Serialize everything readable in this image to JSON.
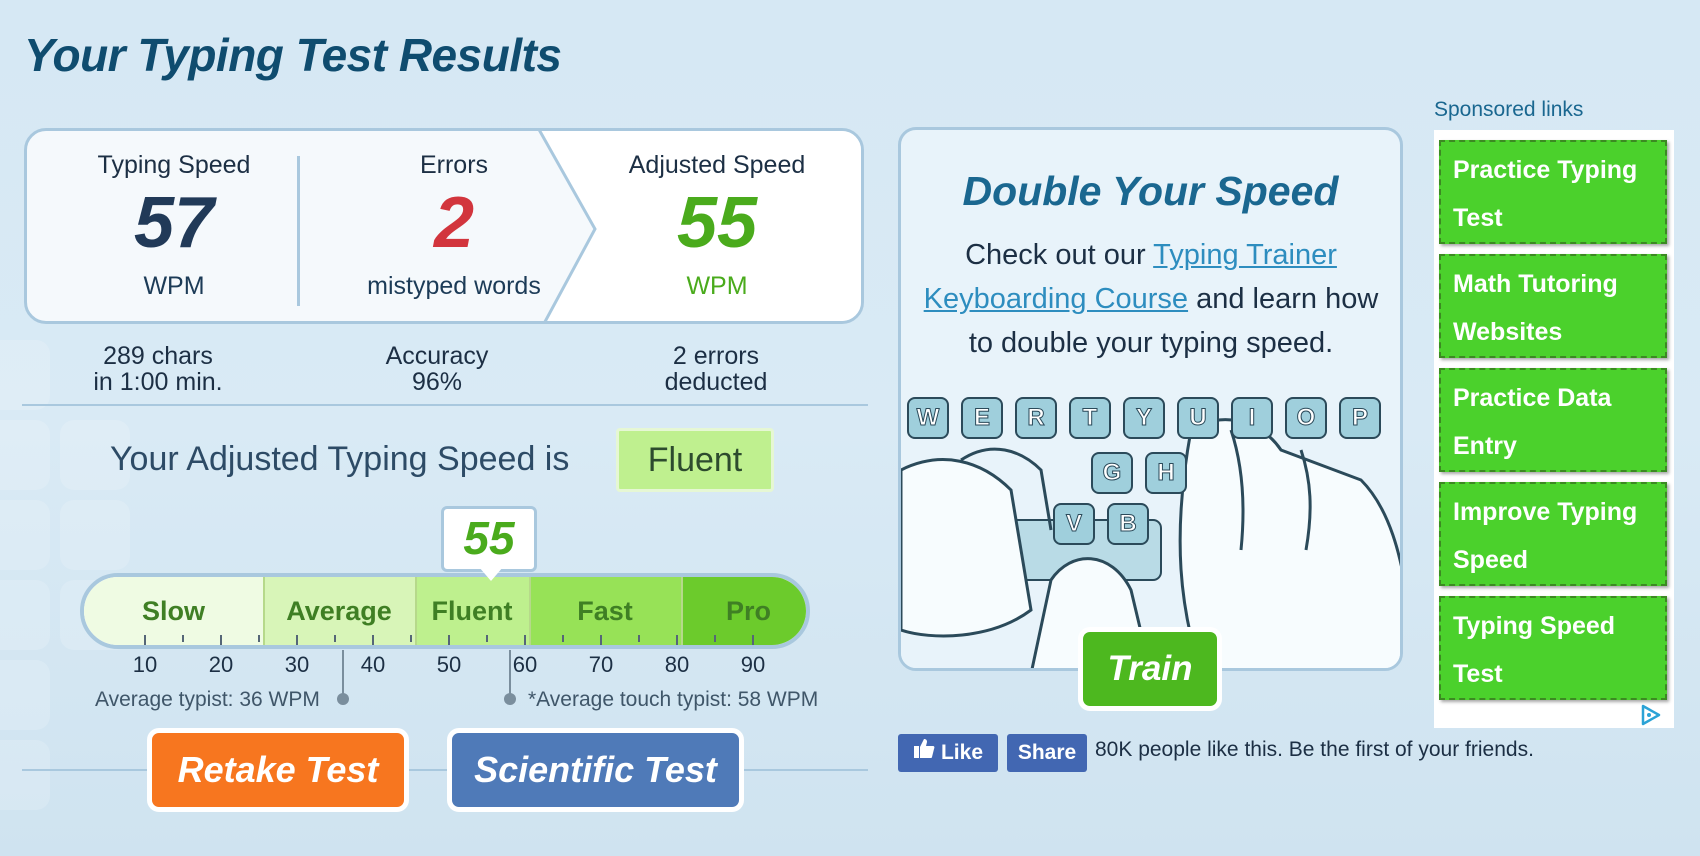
{
  "page": {
    "title": "Your Typing Test Results"
  },
  "results": {
    "typing_speed": {
      "label": "Typing Speed",
      "value": "57",
      "unit": "WPM"
    },
    "errors": {
      "label": "Errors",
      "value": "2",
      "unit": "mistyped words"
    },
    "adjusted_speed": {
      "label": "Adjusted Speed",
      "value": "55",
      "unit": "WPM"
    }
  },
  "sub_stats": {
    "chars": {
      "line1": "289 chars",
      "line2": "in 1:00 min."
    },
    "accuracy": {
      "line1": "Accuracy",
      "line2": "96%"
    },
    "deducted": {
      "line1": "2 errors",
      "line2": "deducted"
    }
  },
  "level": {
    "sentence": "Your Adjusted Typing Speed is",
    "badge": "Fluent"
  },
  "scale": {
    "score": "55",
    "score_value": 55,
    "segments": [
      {
        "label": "Slow",
        "color": "#effbe3"
      },
      {
        "label": "Average",
        "color": "#d8f5b8"
      },
      {
        "label": "Fluent",
        "color": "#bef08e"
      },
      {
        "label": "Fast",
        "color": "#97e257"
      },
      {
        "label": "Pro",
        "color": "#6ccb2c"
      }
    ],
    "ticks": [
      "10",
      "20",
      "30",
      "40",
      "50",
      "60",
      "70",
      "80",
      "90"
    ],
    "average_typist": {
      "label": "Average typist: 36 WPM",
      "value": 36
    },
    "touch_typist": {
      "label": "*Average touch typist: 58 WPM",
      "value": 58
    }
  },
  "buttons": {
    "retake": "Retake Test",
    "scientific": "Scientific Test"
  },
  "promo": {
    "title": "Double Your Speed",
    "text_pre": "Check out our ",
    "link1": "Typing Trainer",
    "link2": "Keyboarding Course",
    "text_post": " and learn how to double your typing speed.",
    "train_button": "Train",
    "keys_row1": [
      "W",
      "E",
      "R",
      "T",
      "Y",
      "U",
      "I",
      "O",
      "P"
    ],
    "keys_row2": [
      "G",
      "H"
    ],
    "keys_row3": [
      "V",
      "B"
    ]
  },
  "facebook": {
    "like": "Like",
    "share": "Share",
    "text": "80K people like this. Be the first of your friends."
  },
  "sponsored": {
    "label": "Sponsored links",
    "links": [
      {
        "line1": "Practice Typing",
        "line2": "Test"
      },
      {
        "line1": "Math Tutoring",
        "line2": "Websites"
      },
      {
        "line1": "Practice Data",
        "line2": "Entry"
      },
      {
        "line1": "Improve Typing",
        "line2": "Speed"
      },
      {
        "line1": "Typing Speed",
        "line2": "Test"
      }
    ]
  },
  "colors": {
    "accent_blue": "#1a6790",
    "error_red": "#d2353d",
    "adjusted_green": "#4aab1c",
    "retake_orange": "#f7761f",
    "scientific_blue": "#4f7ab8",
    "ad_green": "#4bd12c"
  }
}
